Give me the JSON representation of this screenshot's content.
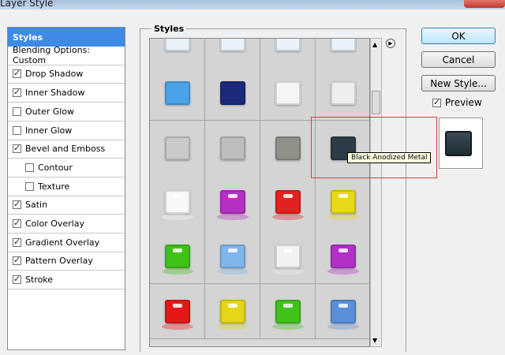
{
  "window": {
    "title": "Layer Style"
  },
  "left_panel": {
    "items": [
      {
        "label": "Styles",
        "selected": true,
        "checkbox": false
      },
      {
        "label": "Blending Options: Custom",
        "checkbox": false
      },
      {
        "label": "Drop Shadow",
        "checkbox": true,
        "checked": true
      },
      {
        "label": "Inner Shadow",
        "checkbox": true,
        "checked": true
      },
      {
        "label": "Outer Glow",
        "checkbox": true,
        "checked": false
      },
      {
        "label": "Inner Glow",
        "checkbox": true,
        "checked": false
      },
      {
        "label": "Bevel and Emboss",
        "checkbox": true,
        "checked": true
      },
      {
        "label": "Contour",
        "checkbox": true,
        "checked": false,
        "sub": true
      },
      {
        "label": "Texture",
        "checkbox": true,
        "checked": false,
        "sub": true
      },
      {
        "label": "Satin",
        "checkbox": true,
        "checked": true
      },
      {
        "label": "Color Overlay",
        "checkbox": true,
        "checked": true
      },
      {
        "label": "Gradient Overlay",
        "checkbox": true,
        "checked": true
      },
      {
        "label": "Pattern Overlay",
        "checkbox": true,
        "checked": true
      },
      {
        "label": "Stroke",
        "checkbox": true,
        "checked": true
      }
    ]
  },
  "styles_group": {
    "label": "Styles"
  },
  "buttons": {
    "ok": "OK",
    "cancel": "Cancel",
    "new_style": "New Style..."
  },
  "preview": {
    "label": "Preview",
    "checked": true
  },
  "tooltip": {
    "text": "Black Anodized Metal"
  },
  "swatches": [
    [
      "#e8f2f8",
      "#e9f1fb",
      "#e9f1fb",
      "#e9f1fb"
    ],
    [
      "#4aa3e8",
      "#1c2a7a",
      "#f5f5f5",
      "#eeeeee"
    ],
    [
      "#c9c9c9",
      "#bdbdbd",
      "#909088",
      "#2c3b45"
    ],
    [
      "#f8f8f8",
      "#b52fc4",
      "#e52020",
      "#e8d81a"
    ],
    [
      "#3fc218",
      "#7fb6ec",
      "#f2f2f2",
      "#b22fc8"
    ],
    [
      "#e51818",
      "#e6d618",
      "#3fc218",
      "#5b8fd8"
    ]
  ],
  "colors": {
    "accent": "#3f8ae6",
    "highlight_box": "#d43c3c"
  }
}
